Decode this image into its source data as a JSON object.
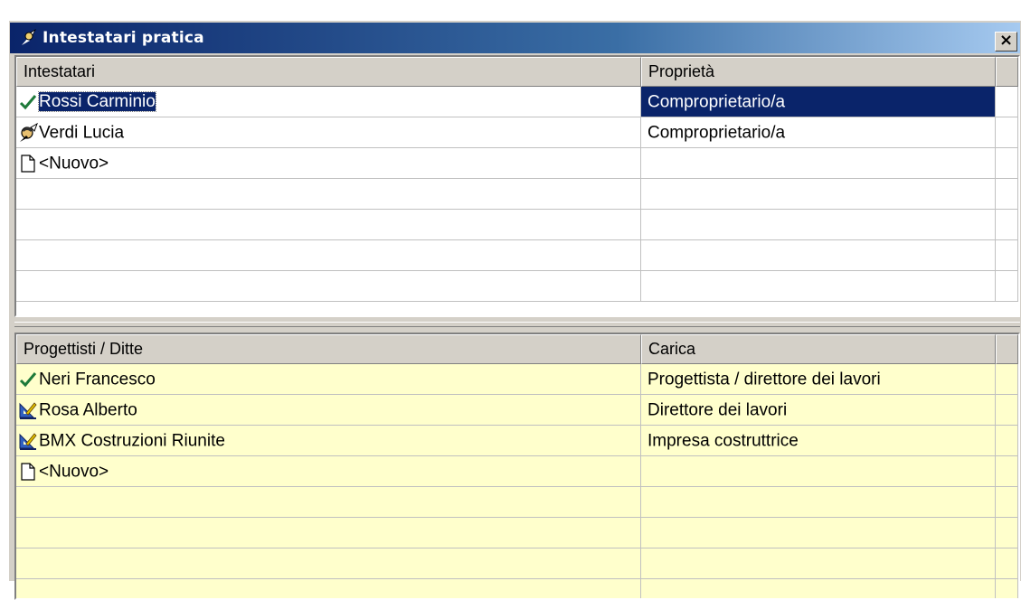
{
  "window": {
    "title": "Intestatari pratica",
    "close_label": "×"
  },
  "owners_grid": {
    "headers": [
      "Intestatari",
      "Proprietà"
    ],
    "rows": [
      {
        "icon": "checkmark-icon",
        "name": "Rossi Carminio",
        "value": "Comproprietario/a",
        "selected": true
      },
      {
        "icon": "person-quill-icon",
        "name": "Verdi Lucia",
        "value": "Comproprietario/a",
        "selected": false
      },
      {
        "icon": "new-document-icon",
        "name": "<Nuovo>",
        "value": "",
        "selected": false
      }
    ]
  },
  "designers_grid": {
    "headers": [
      "Progettisti / Ditte",
      "Carica"
    ],
    "rows": [
      {
        "icon": "checkmark-icon",
        "name": "Neri Francesco",
        "value": "Progettista / direttore dei lavori"
      },
      {
        "icon": "drafting-tools-icon",
        "name": "Rosa Alberto",
        "value": "Direttore dei lavori"
      },
      {
        "icon": "drafting-tools-icon",
        "name": "BMX Costruzioni Riunite",
        "value": "Impresa costruttrice"
      },
      {
        "icon": "new-document-icon",
        "name": "<Nuovo>",
        "value": ""
      }
    ]
  },
  "colors": {
    "title_bar_start": "#0a246a",
    "title_bar_end": "#a6caf0",
    "selection": "#0a246a",
    "designers_background": "#ffffcc",
    "checkmark": "#1e7a3a"
  }
}
